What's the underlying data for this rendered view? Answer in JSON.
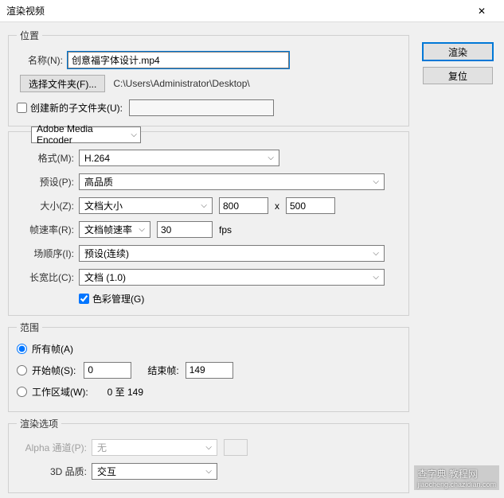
{
  "window": {
    "title": "渲染视频",
    "close": "✕"
  },
  "location": {
    "legend": "位置",
    "name_label": "名称(N):",
    "name_value": "创意福字体设计.mp4",
    "folder_btn": "选择文件夹(F)...",
    "folder_path": "C:\\Users\\Administrator\\Desktop\\",
    "subfolder_label": "创建新的子文件夹(U):",
    "subfolder_value": ""
  },
  "encoder": {
    "engine": "Adobe Media Encoder",
    "format_label": "格式(M):",
    "format_value": "H.264",
    "preset_label": "预设(P):",
    "preset_value": "高品质",
    "size_label": "大小(Z):",
    "size_mode": "文档大小",
    "width": "800",
    "x_sep": "x",
    "height": "500",
    "fps_label": "帧速率(R):",
    "fps_mode": "文档帧速率",
    "fps_value": "30",
    "fps_unit": "fps",
    "field_label": "场顺序(I):",
    "field_value": "预设(连续)",
    "aspect_label": "长宽比(C):",
    "aspect_value": "文档 (1.0)",
    "color_mgmt": "色彩管理(G)"
  },
  "range": {
    "legend": "范围",
    "all_label": "所有帧(A)",
    "start_label": "开始帧(S):",
    "start_value": "0",
    "end_label": "结束帧:",
    "end_value": "149",
    "work_label": "工作区域(W):",
    "work_range": "0 至 149"
  },
  "render_opts": {
    "legend": "渲染选项",
    "alpha_label": "Alpha 通道(P):",
    "alpha_value": "无",
    "quality_label": "3D 品质:",
    "quality_value": "交互"
  },
  "buttons": {
    "render": "渲染",
    "reset": "复位"
  },
  "watermark": {
    "line1": "查字典 教程网",
    "line2": "jiaocheng.chazidian.com"
  }
}
